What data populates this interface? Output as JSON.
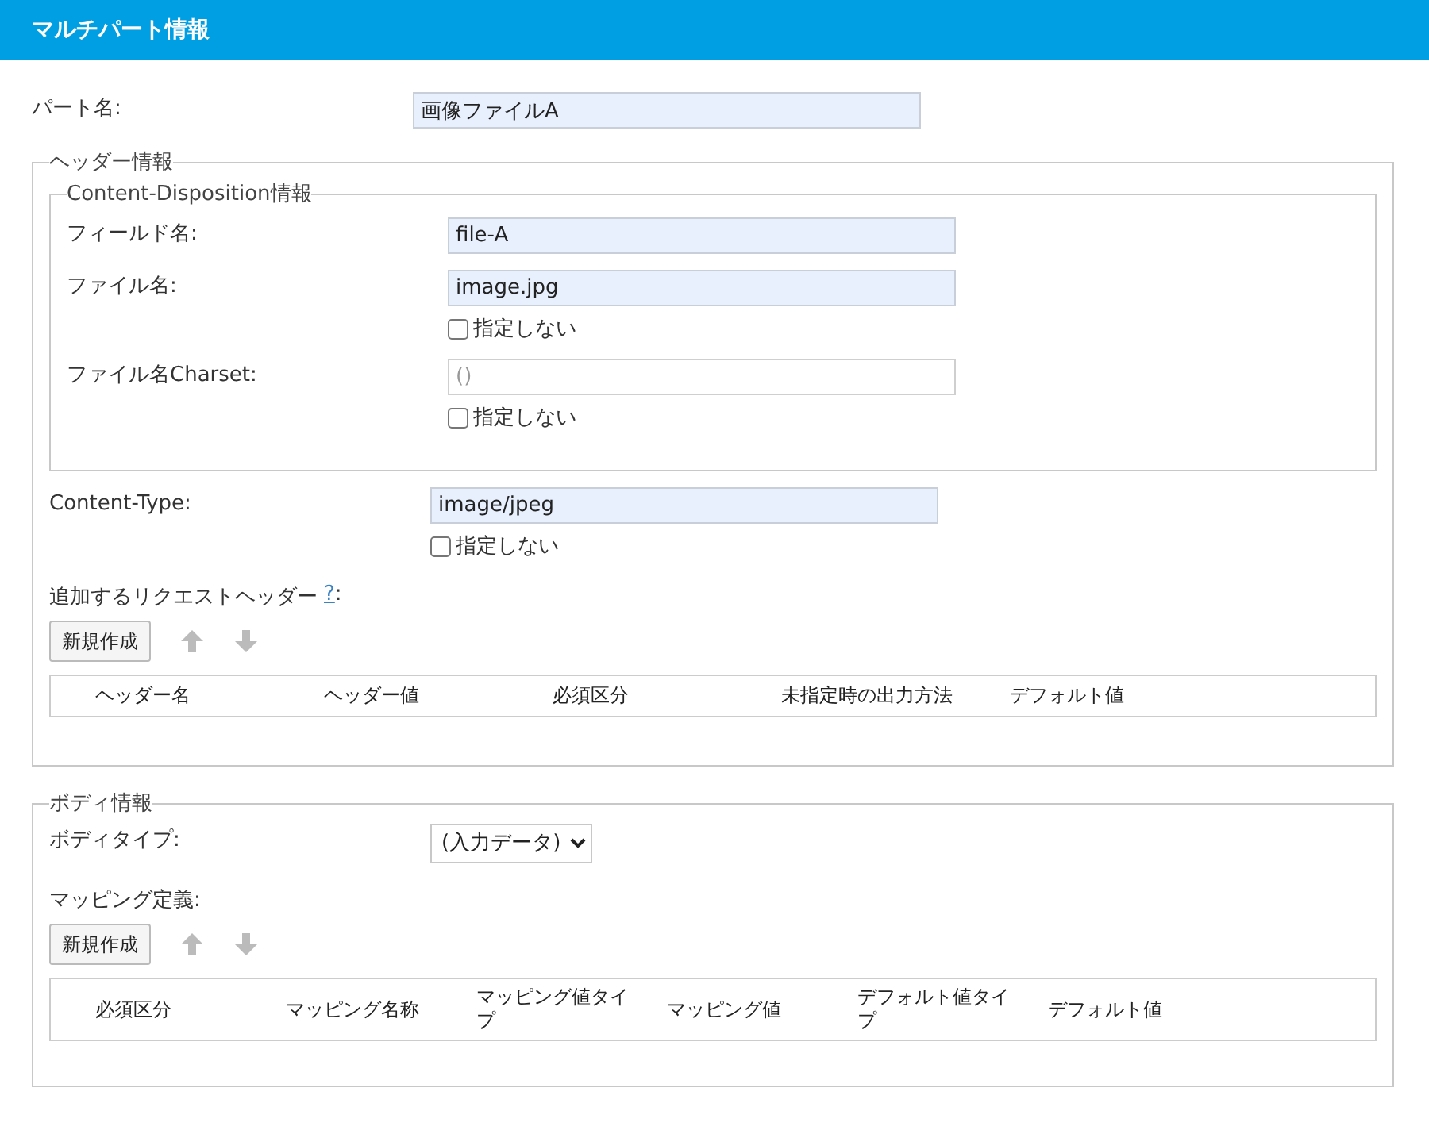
{
  "title": "マルチパート情報",
  "part_name": {
    "label": "パート名:",
    "value": "画像ファイルA"
  },
  "header_info": {
    "legend": "ヘッダー情報",
    "content_disposition": {
      "legend": "Content-Disposition情報",
      "fields": [
        {
          "label": "フィールド名:",
          "value": "file-A"
        },
        {
          "label": "ファイル名:",
          "value": "image.jpg",
          "checkbox": {
            "label": "指定しない",
            "checked": false
          }
        },
        {
          "label": "ファイル名Charset:",
          "placeholder": "()",
          "checkbox": {
            "label": "指定しない",
            "checked": false
          }
        }
      ]
    },
    "content_type": {
      "label": "Content-Type:",
      "value": "image/jpeg",
      "checkbox": {
        "label": "指定しない",
        "checked": false
      }
    },
    "request_headers": {
      "label": "追加するリクエストヘッダー",
      "help": "?",
      "suffix": ":",
      "new_button": "新規作成",
      "move_buttons": [
        {
          "kind": "up",
          "disabled": true
        },
        {
          "kind": "down",
          "disabled": true
        }
      ],
      "columns": [
        "ヘッダー名",
        "ヘッダー値",
        "必須区分",
        "未指定時の出力方法",
        "デフォルト値"
      ]
    }
  },
  "body_info": {
    "legend": "ボディ情報",
    "body_type": {
      "label": "ボディタイプ:",
      "value": "(入力データ)"
    },
    "mapping": {
      "label": "マッピング定義:",
      "new_button": "新規作成",
      "move_buttons": [
        {
          "kind": "up",
          "disabled": true
        },
        {
          "kind": "down",
          "disabled": true
        }
      ],
      "columns": [
        "必須区分",
        "マッピング名称",
        "マッピング値タイプ",
        "マッピング値",
        "デフォルト値タイプ",
        "デフォルト値"
      ]
    }
  }
}
